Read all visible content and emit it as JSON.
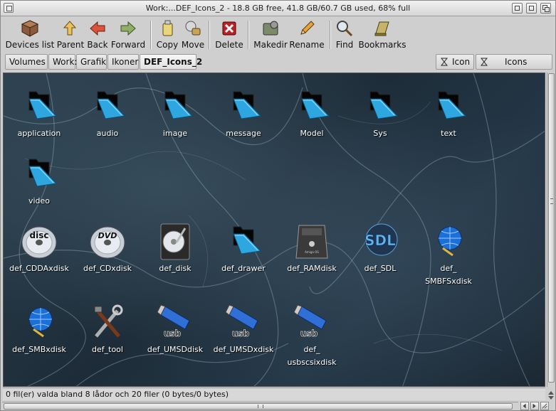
{
  "window": {
    "title": "Work:...DEF_Icons_2 - 18.8 GB free, 41.8 GB/60.7 GB used, 68% full"
  },
  "toolbar": {
    "devices_list": "Devices list",
    "parent": "Parent",
    "back": "Back",
    "forward": "Forward",
    "copy": "Copy",
    "move": "Move",
    "delete": "Delete",
    "makedir": "Makedir",
    "rename": "Rename",
    "find": "Find",
    "bookmarks": "Bookmarks"
  },
  "path": {
    "crumbs": [
      "Volumes",
      "Work:",
      "Grafik",
      "Ikoner",
      "DEF_Icons_2"
    ],
    "view_mode": "Icon",
    "view_type": "Icons"
  },
  "drawers": [
    {
      "label": "application",
      "icon": "folder-icon"
    },
    {
      "label": "audio",
      "icon": "folder-icon"
    },
    {
      "label": "image",
      "icon": "folder-icon"
    },
    {
      "label": "message",
      "icon": "folder-icon"
    },
    {
      "label": "Model",
      "icon": "folder-icon"
    },
    {
      "label": "Sys",
      "icon": "folder-icon"
    },
    {
      "label": "text",
      "icon": "folder-icon"
    },
    {
      "label": "video",
      "icon": "folder-icon"
    }
  ],
  "files": [
    {
      "label": "def_CDDAxdisk",
      "icon": "cd-disc-icon",
      "disc_text": "disc"
    },
    {
      "label": "def_CDxdisk",
      "icon": "dvd-disc-icon",
      "disc_text": "DVD"
    },
    {
      "label": "def_disk",
      "icon": "hard-disk-icon"
    },
    {
      "label": "def_drawer",
      "icon": "folder-icon"
    },
    {
      "label": "def_RAMdisk",
      "icon": "ram-disk-icon",
      "device_text": "Amiga OS"
    },
    {
      "label": "def_SDL",
      "icon": "sdl-icon",
      "logo_text": "SDL"
    },
    {
      "label": "def_\nSMBFSxdisk",
      "icon": "globe-network-icon"
    },
    {
      "label": "def_SMBxdisk",
      "icon": "globe-network-icon"
    },
    {
      "label": "def_tool",
      "icon": "tools-icon"
    },
    {
      "label": "def_UMSDdisk",
      "icon": "usb-stick-icon",
      "usb_text": "usb"
    },
    {
      "label": "def_UMSDxdisk",
      "icon": "usb-stick-icon",
      "usb_text": "usb"
    },
    {
      "label": "def_\nusbscsixdisk",
      "icon": "usb-stick-icon",
      "usb_text": "usb"
    }
  ],
  "status": {
    "text": "0 fil(er) valda bland 8 lådor och 20 filer (0 bytes/0 bytes)"
  },
  "colors": {
    "folder": "#2ea6e0",
    "background": "#22333f"
  }
}
